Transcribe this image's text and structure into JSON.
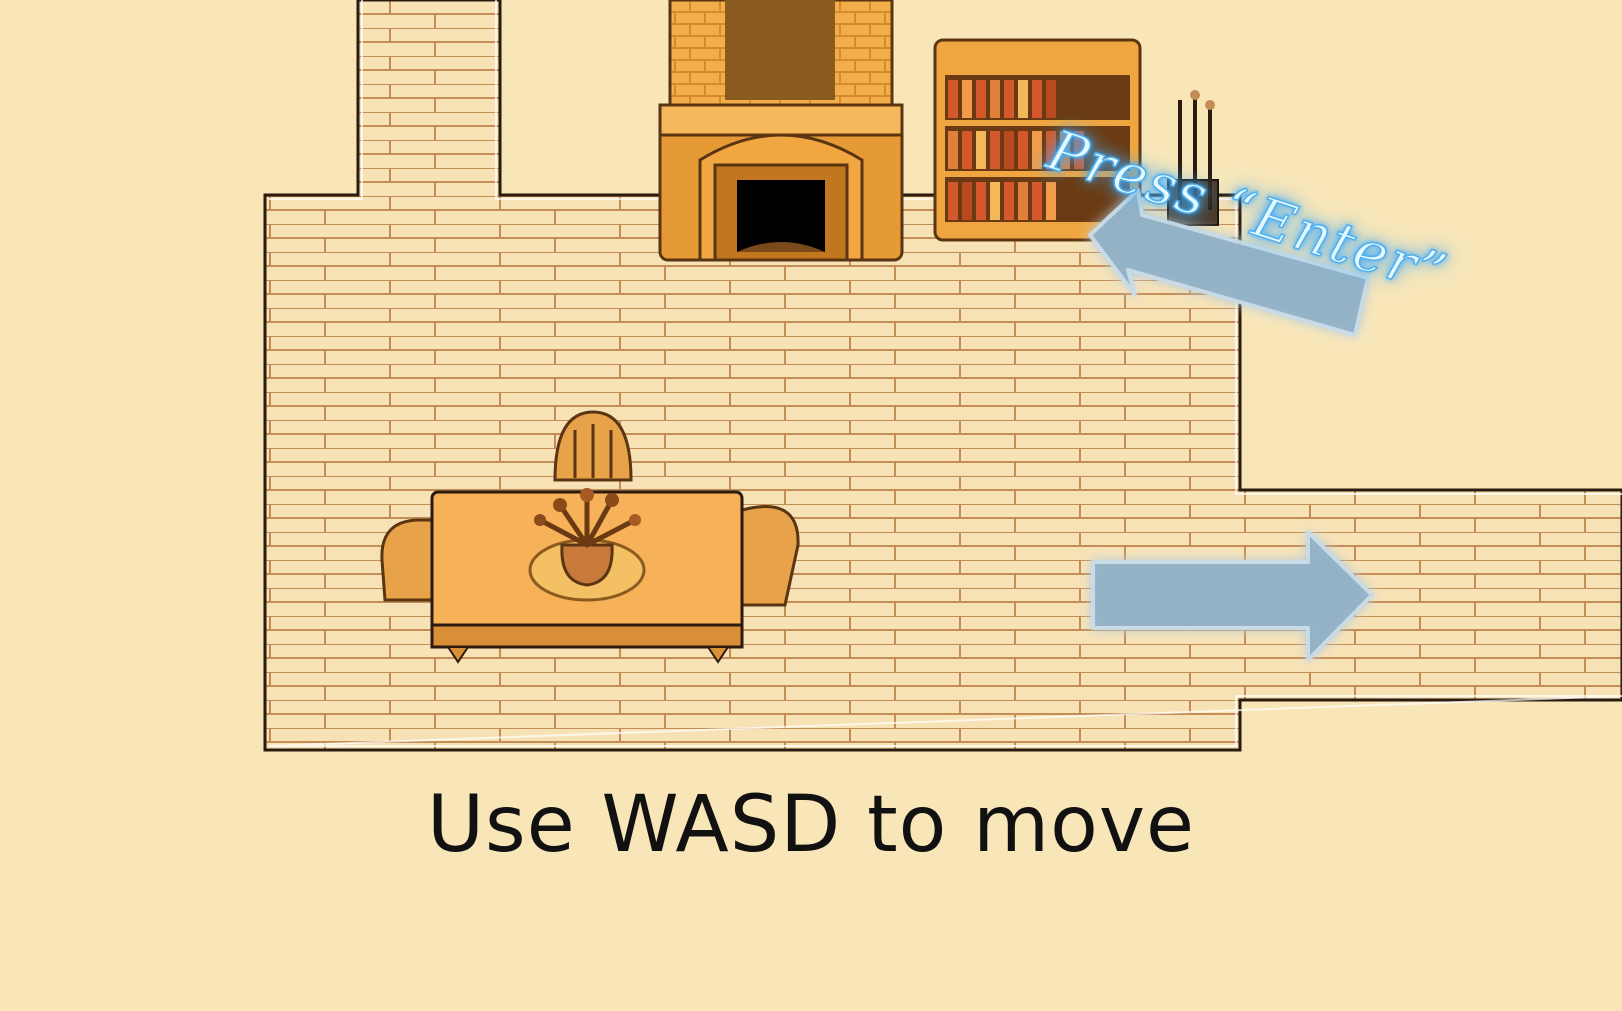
{
  "scene": {
    "colors": {
      "background": "#f8e6b9",
      "floor": "#f7e2b6",
      "plank_line": "#c48d55",
      "wall_outline": "#2a1a10",
      "wood": "#e8a24a",
      "wood_dark": "#8b5a1f",
      "arrow_fill": "#93b3c7",
      "glow": "#49b4ff"
    },
    "objects": [
      {
        "name": "fireplace-icon"
      },
      {
        "name": "bookshelf-icon"
      },
      {
        "name": "fire-tools-icon"
      },
      {
        "name": "dining-table-icon"
      },
      {
        "name": "chair-icon"
      },
      {
        "name": "flower-vase-icon"
      }
    ]
  },
  "hints": {
    "interact_prompt": "Press “Enter”",
    "move_instruction": "Use WASD to move"
  }
}
